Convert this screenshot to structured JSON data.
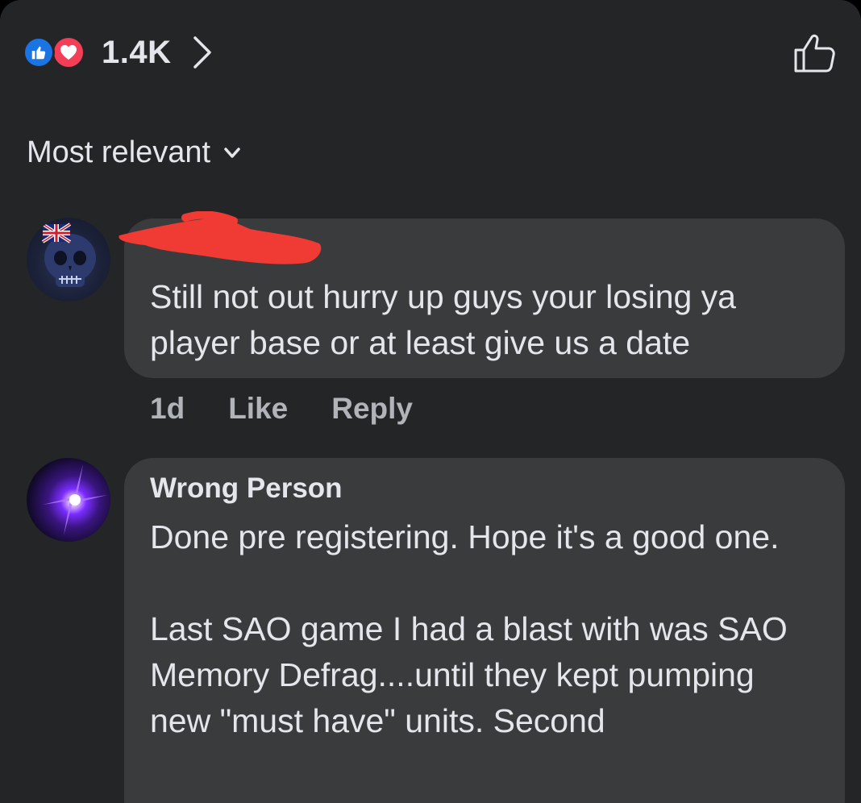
{
  "reactions": {
    "count": "1.4K",
    "icons": [
      "like-icon",
      "love-icon"
    ],
    "like_color": "#1b74e4",
    "love_color": "#f33e58"
  },
  "sort": {
    "label": "Most relevant"
  },
  "comments": [
    {
      "author": "",
      "author_redacted": true,
      "text": "Still not out hurry up guys your losing ya player base or at least give  us a date",
      "time": "1d",
      "like_label": "Like",
      "reply_label": "Reply"
    },
    {
      "author": "Wrong Person",
      "text": "Done pre registering. Hope it's a good one.\n\nLast SAO game I had a blast with was SAO Memory Defrag....until they kept pumping new \"must have\" units. Second"
    }
  ],
  "colors": {
    "background": "#242526",
    "bubble": "#3a3b3c",
    "text_primary": "#e4e6eb",
    "text_secondary": "#b0b3b8",
    "redaction": "#ef3b33"
  }
}
